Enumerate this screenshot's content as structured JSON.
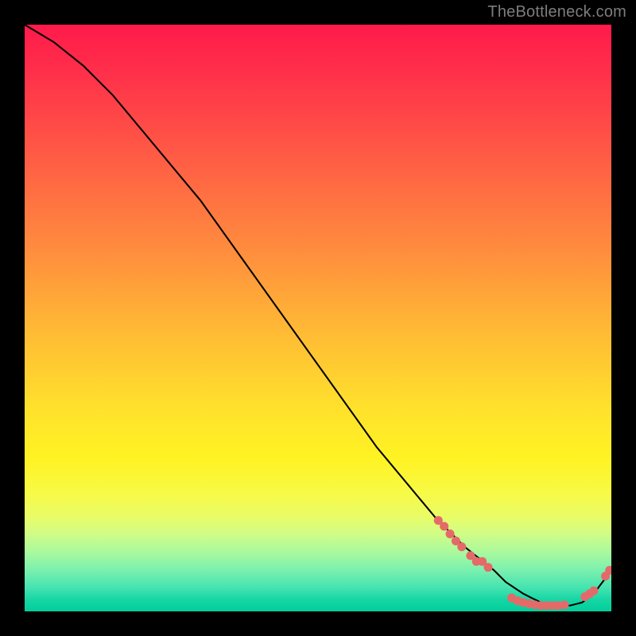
{
  "watermark": "TheBottleneck.com",
  "chart_data": {
    "type": "line",
    "title": "",
    "xlabel": "",
    "ylabel": "",
    "xlim": [
      0,
      100
    ],
    "ylim": [
      0,
      100
    ],
    "grid": false,
    "legend": false,
    "curve": {
      "name": "bottleneck-curve",
      "x": [
        0,
        5,
        10,
        15,
        20,
        25,
        30,
        35,
        40,
        45,
        50,
        55,
        60,
        65,
        70,
        75,
        80,
        82,
        85,
        88,
        90,
        93,
        95,
        97,
        100
      ],
      "y": [
        100,
        97,
        93,
        88,
        82,
        76,
        70,
        63,
        56,
        49,
        42,
        35,
        28,
        22,
        16,
        11,
        7,
        5,
        3,
        1.5,
        1,
        1,
        1.5,
        3,
        7
      ]
    },
    "marker_clusters": [
      {
        "name": "left-cluster",
        "color": "#e46a6a",
        "points": [
          {
            "x": 70.5,
            "y": 15.5
          },
          {
            "x": 71.5,
            "y": 14.5
          },
          {
            "x": 72.5,
            "y": 13.2
          },
          {
            "x": 73.5,
            "y": 12.0
          },
          {
            "x": 74.5,
            "y": 11.0
          },
          {
            "x": 76.0,
            "y": 9.5
          },
          {
            "x": 77.0,
            "y": 8.5
          },
          {
            "x": 78.0,
            "y": 8.5
          },
          {
            "x": 79.0,
            "y": 7.5
          }
        ]
      },
      {
        "name": "bottom-cluster",
        "color": "#e46a6a",
        "points": [
          {
            "x": 83.0,
            "y": 2.3
          },
          {
            "x": 84.0,
            "y": 1.8
          },
          {
            "x": 85.0,
            "y": 1.5
          },
          {
            "x": 86.0,
            "y": 1.3
          },
          {
            "x": 87.0,
            "y": 1.1
          },
          {
            "x": 88.0,
            "y": 1.0
          },
          {
            "x": 89.0,
            "y": 1.0
          },
          {
            "x": 90.0,
            "y": 1.0
          },
          {
            "x": 91.0,
            "y": 1.0
          },
          {
            "x": 92.0,
            "y": 1.1
          }
        ]
      },
      {
        "name": "right-cluster",
        "color": "#e46a6a",
        "points": [
          {
            "x": 95.5,
            "y": 2.5
          },
          {
            "x": 96.3,
            "y": 3.0
          },
          {
            "x": 97.0,
            "y": 3.5
          },
          {
            "x": 99.0,
            "y": 6.0
          },
          {
            "x": 99.7,
            "y": 7.0
          }
        ]
      }
    ]
  }
}
